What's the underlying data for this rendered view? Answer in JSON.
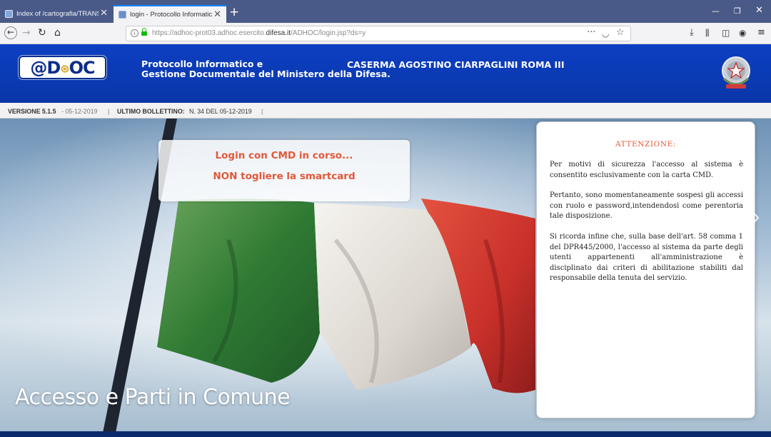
{
  "browser": {
    "tabs": [
      {
        "title": "Index of /cartografia/TRANSIT",
        "active": false
      },
      {
        "title": "login - Protocollo Informatico",
        "active": true
      }
    ],
    "new_tab_icon": "plus-icon",
    "window_controls": [
      "minimize-icon",
      "restore-icon",
      "close-icon"
    ],
    "nav_icons": [
      "back-arrow-icon",
      "forward-arrow-icon",
      "reload-icon",
      "home-icon"
    ],
    "url": {
      "prefix": "https://adhoc-prot03.adhoc.esercito.",
      "domain": "difesa.it",
      "suffix": "/ADHOC/login.jsp?ds=y"
    },
    "url_right_icons": [
      "more-dots-icon",
      "pocket-icon",
      "bookmark-star-icon"
    ],
    "toolbar_icons": [
      "download-icon",
      "library-icon",
      "sidebar-icon",
      "account-icon",
      "menu-icon"
    ]
  },
  "header": {
    "logo_text": "@D",
    "logo_text_tail": "C",
    "subtitle_line1": "Protocollo Informatico e",
    "subtitle_line2": "Gestione Documentale del Ministero della Difesa.",
    "caserma": "CASERMA AGOSTINO CIARPAGLINI ROMA III",
    "emblem": "italian-republic-emblem"
  },
  "version_bar": {
    "version_label": "VERSIONE 5.1.5",
    "version_date": "- 05-12-2019",
    "sep1": "|",
    "bollettino_label": "ULTIMO BOLLETTINO:",
    "bollettino_value": "N. 34 DEL 05-12-2019",
    "sep2": "|"
  },
  "login": {
    "line1": "Login con CMD in corso...",
    "line2": "NON togliere la smartcard"
  },
  "hero": {
    "title": "Accesso e Parti in Comune",
    "image": "italian-flag-photo"
  },
  "notice": {
    "heading": "ATTENZIONE:",
    "p1": "Per motivi di sicurezza l'accesso al sistema è consentito esclusivamente con la carta CMD.",
    "p2": "Pertanto, sono momentaneamente sospesi gli accessi con ruolo e password,intendendosi come perentoria tale disposizione.",
    "p3": "Si ricorda infine che, sulla base dell'art. 58 comma 1 del DPR445/2000, l'accesso al sistema da parte degli utenti appartenenti all'amministrazione è disciplinato dai criteri di abilitazione stabiliti dal responsabile della tenuta del servizio."
  },
  "colors": {
    "brand_blue": "#0c3fc2",
    "alert_orange": "#e2583a",
    "flag_green": "#3f8a3b",
    "flag_white": "#eeeeee",
    "flag_red": "#d8362a"
  }
}
